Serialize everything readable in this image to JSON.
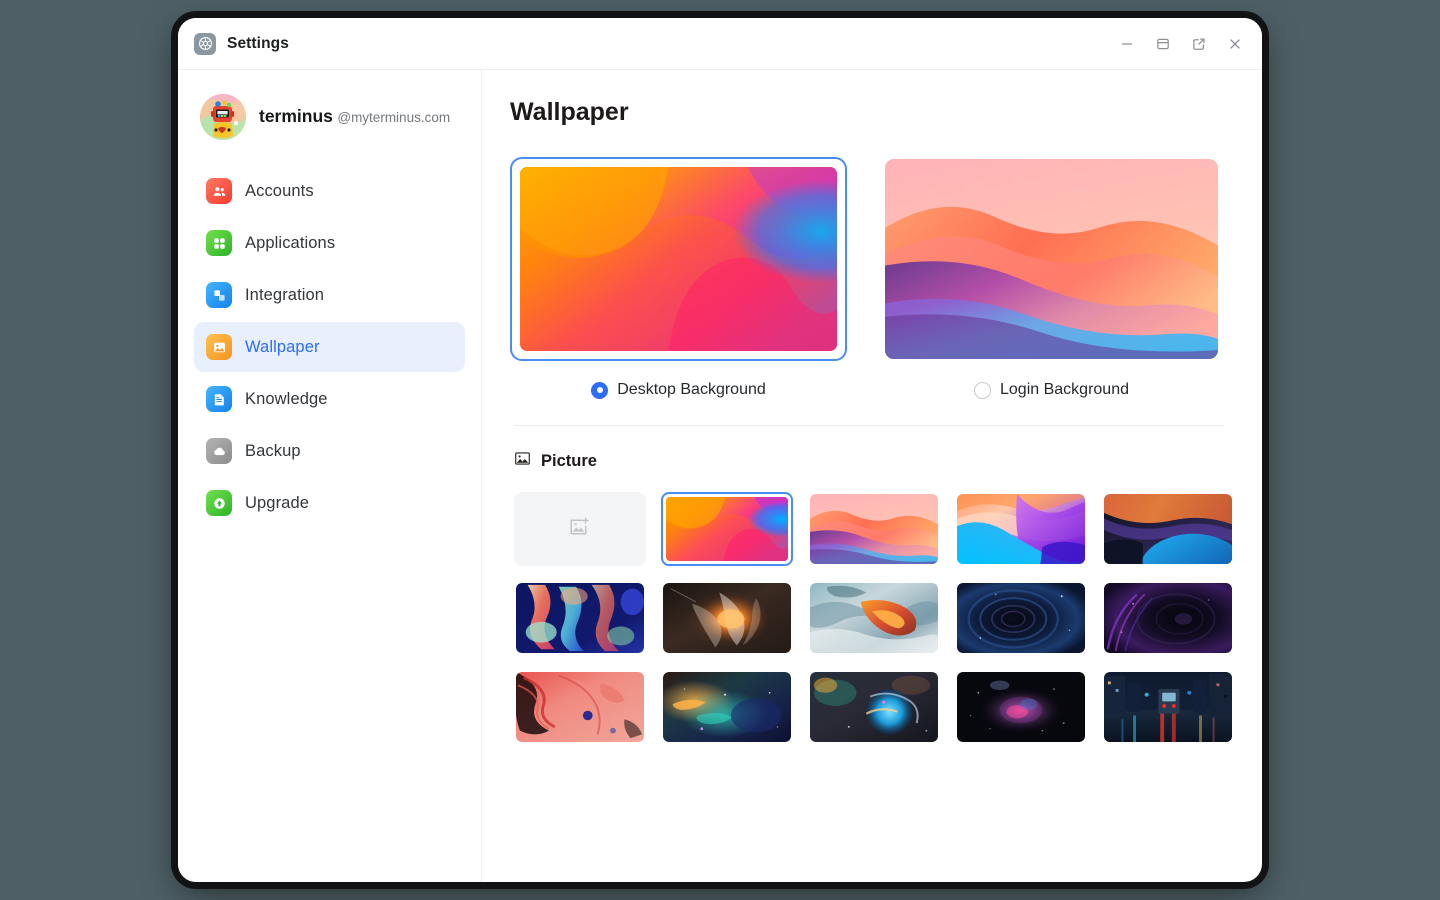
{
  "window": {
    "app_icon": "settings-gear-icon",
    "title": "Settings",
    "controls": [
      {
        "name": "minimize-button",
        "icon": "minimize-icon"
      },
      {
        "name": "restore-button",
        "icon": "window-split-icon"
      },
      {
        "name": "popout-button",
        "icon": "external-link-icon"
      },
      {
        "name": "close-button",
        "icon": "close-icon"
      }
    ]
  },
  "sidebar": {
    "profile": {
      "avatar": "user-avatar",
      "name": "terminus",
      "handle": "@myterminus.com"
    },
    "items": [
      {
        "label": "Accounts",
        "icon": "accounts-icon",
        "color": "#fb5f52",
        "active": false
      },
      {
        "label": "Applications",
        "icon": "applications-icon",
        "color": "#4dcb43",
        "active": false
      },
      {
        "label": "Integration",
        "icon": "integration-icon",
        "color": "#2196f3",
        "active": false
      },
      {
        "label": "Wallpaper",
        "icon": "wallpaper-icon",
        "color": "#f5a623",
        "active": true
      },
      {
        "label": "Knowledge",
        "icon": "knowledge-icon",
        "color": "#2196f3",
        "active": false
      },
      {
        "label": "Backup",
        "icon": "backup-icon",
        "color": "#9a9a9a",
        "active": false
      },
      {
        "label": "Upgrade",
        "icon": "upgrade-icon",
        "color": "#4dcb43",
        "active": false
      }
    ]
  },
  "main": {
    "title": "Wallpaper",
    "previews": [
      {
        "id": "desktop",
        "label": "Desktop Background",
        "selected": true,
        "image": "gradient-orange-pink"
      },
      {
        "id": "login",
        "label": "Login Background",
        "selected": false,
        "image": "gradient-sunset-dunes"
      }
    ],
    "picture_section": {
      "icon": "picture-icon",
      "title": "Picture",
      "tiles": [
        {
          "name": "add-picture-tile",
          "type": "add",
          "icon": "image-plus-icon",
          "selected": false
        },
        {
          "name": "wallpaper-thumb-1",
          "type": "image",
          "image": "gradient-orange-pink",
          "selected": true
        },
        {
          "name": "wallpaper-thumb-2",
          "type": "image",
          "image": "gradient-sunset-dunes",
          "selected": false
        },
        {
          "name": "wallpaper-thumb-3",
          "type": "image",
          "image": "gradient-purple-cyan",
          "selected": false
        },
        {
          "name": "wallpaper-thumb-4",
          "type": "image",
          "image": "gradient-dark-blue-orange",
          "selected": false
        },
        {
          "name": "wallpaper-thumb-5",
          "type": "image",
          "image": "abstract-navy-ribbons",
          "selected": false
        },
        {
          "name": "wallpaper-thumb-6",
          "type": "image",
          "image": "smoke-amber-swirl",
          "selected": false
        },
        {
          "name": "wallpaper-thumb-7",
          "type": "image",
          "image": "marble-teal-orange",
          "selected": false
        },
        {
          "name": "wallpaper-thumb-8",
          "type": "image",
          "image": "deep-space-vortex-blue",
          "selected": false
        },
        {
          "name": "wallpaper-thumb-9",
          "type": "image",
          "image": "deep-space-vortex-purple",
          "selected": false
        },
        {
          "name": "wallpaper-thumb-10",
          "type": "image",
          "image": "red-fluid-marble",
          "selected": false
        },
        {
          "name": "wallpaper-thumb-11",
          "type": "image",
          "image": "nebula-teal-amber",
          "selected": false
        },
        {
          "name": "wallpaper-thumb-12",
          "type": "image",
          "image": "nebula-blue-sphere",
          "selected": false
        },
        {
          "name": "wallpaper-thumb-13",
          "type": "image",
          "image": "galaxy-dark-pink",
          "selected": false
        },
        {
          "name": "wallpaper-thumb-14",
          "type": "image",
          "image": "rainy-night-street",
          "selected": false
        }
      ]
    }
  },
  "colors": {
    "accent": "#2d6cf6",
    "selection_border": "#4b8bf4",
    "active_nav_bg": "#e8f0fe",
    "desktop_bg": "#4e6066"
  }
}
